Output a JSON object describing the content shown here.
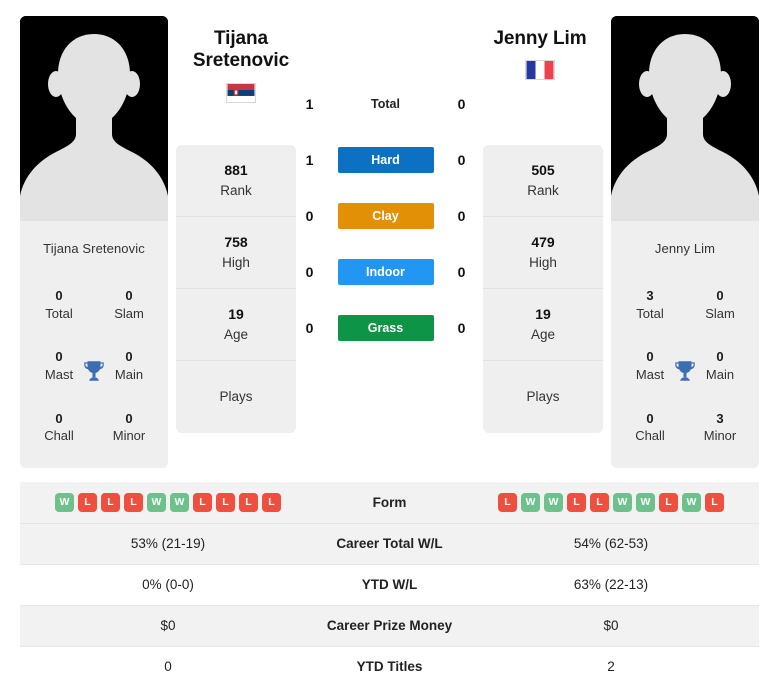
{
  "players": {
    "left": {
      "name": "Tijana Sretenovic",
      "display_name_line1": "Tijana",
      "display_name_line2": "Sretenovic",
      "country": "Serbia",
      "flag_icon": "flag-serbia",
      "avatar_icon": "player-avatar-placeholder",
      "trophies": [
        {
          "value": "0",
          "label": "Total"
        },
        {
          "value": "0",
          "label": "Slam"
        },
        {
          "value": "0",
          "label": "Mast"
        },
        {
          "value": "0",
          "label": "Main"
        },
        {
          "value": "0",
          "label": "Chall"
        },
        {
          "value": "0",
          "label": "Minor"
        }
      ],
      "rank_stats": [
        {
          "value": "881",
          "label": "Rank"
        },
        {
          "value": "758",
          "label": "High"
        },
        {
          "value": "19",
          "label": "Age"
        },
        {
          "value": "",
          "label": "Plays"
        }
      ],
      "form": [
        "W",
        "L",
        "L",
        "L",
        "W",
        "W",
        "L",
        "L",
        "L",
        "L"
      ],
      "career_total_wl": "53% (21-19)",
      "ytd_wl": "0% (0-0)",
      "career_prize_money": "$0",
      "ytd_titles": "0"
    },
    "right": {
      "name": "Jenny Lim",
      "display_name_line1": "Jenny Lim",
      "display_name_line2": "",
      "country": "France",
      "flag_icon": "flag-france",
      "avatar_icon": "player-avatar-placeholder",
      "trophies": [
        {
          "value": "3",
          "label": "Total"
        },
        {
          "value": "0",
          "label": "Slam"
        },
        {
          "value": "0",
          "label": "Mast"
        },
        {
          "value": "0",
          "label": "Main"
        },
        {
          "value": "0",
          "label": "Chall"
        },
        {
          "value": "3",
          "label": "Minor"
        }
      ],
      "rank_stats": [
        {
          "value": "505",
          "label": "Rank"
        },
        {
          "value": "479",
          "label": "High"
        },
        {
          "value": "19",
          "label": "Age"
        },
        {
          "value": "",
          "label": "Plays"
        }
      ],
      "form": [
        "L",
        "W",
        "W",
        "L",
        "L",
        "W",
        "W",
        "L",
        "W",
        "L"
      ],
      "career_total_wl": "54% (62-53)",
      "ytd_wl": "63% (22-13)",
      "career_prize_money": "$0",
      "ytd_titles": "2"
    }
  },
  "head_to_head": [
    {
      "label": "Total",
      "left": "1",
      "right": "0",
      "color": "",
      "style": "plain"
    },
    {
      "label": "Hard",
      "left": "1",
      "right": "0",
      "color": "#0c71c3",
      "style": "pill"
    },
    {
      "label": "Clay",
      "left": "0",
      "right": "0",
      "color": "#e29106",
      "style": "pill"
    },
    {
      "label": "Indoor",
      "left": "0",
      "right": "0",
      "color": "#2196f3",
      "style": "pill"
    },
    {
      "label": "Grass",
      "left": "0",
      "right": "0",
      "color": "#0d9447",
      "style": "pill"
    }
  ],
  "table_rows": [
    {
      "label": "Form",
      "key": "form",
      "type": "badges"
    },
    {
      "label": "Career Total W/L",
      "key": "career_total_wl",
      "type": "text"
    },
    {
      "label": "YTD W/L",
      "key": "ytd_wl",
      "type": "text"
    },
    {
      "label": "Career Prize Money",
      "key": "career_prize_money",
      "type": "text"
    },
    {
      "label": "YTD Titles",
      "key": "ytd_titles",
      "type": "text"
    }
  ],
  "colors": {
    "win_badge": "#6ec18a",
    "loss_badge": "#ef4f3e",
    "trophy": "#3c6eb4",
    "card_bg": "#efefef",
    "row_alt_bg": "#f2f2f2"
  }
}
